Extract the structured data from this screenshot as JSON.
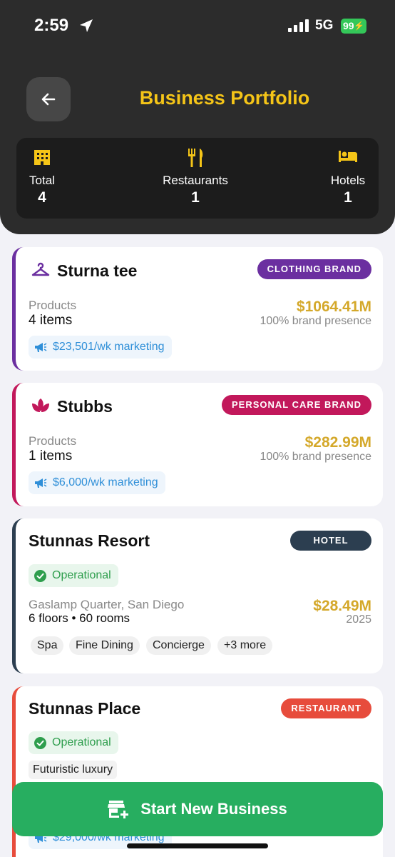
{
  "status_bar": {
    "time": "2:59",
    "network": "5G",
    "battery": "99"
  },
  "header": {
    "title": "Business Portfolio"
  },
  "stats": [
    {
      "label": "Total",
      "value": "4",
      "icon": "building-icon"
    },
    {
      "label": "Restaurants",
      "value": "1",
      "icon": "fork-knife-icon"
    },
    {
      "label": "Hotels",
      "value": "1",
      "icon": "bed-icon"
    }
  ],
  "cards": [
    {
      "name": "Sturna tee",
      "badge": "CLOTHING BRAND",
      "badge_color": "#6b2fa0",
      "accent": "#6b2fa0",
      "icon": "hanger-icon",
      "products_label": "Products",
      "products_value": "4 items",
      "value": "$1064.41M",
      "presence": "100% brand presence",
      "marketing": "$23,501/wk marketing"
    },
    {
      "name": "Stubbs",
      "badge": "PERSONAL CARE BRAND",
      "badge_color": "#c2185b",
      "accent": "#c2185b",
      "icon": "lotus-icon",
      "products_label": "Products",
      "products_value": "1 items",
      "value": "$282.99M",
      "presence": "100% brand presence",
      "marketing": "$6,000/wk marketing"
    },
    {
      "name": "Stunnas Resort",
      "badge": "HOTEL",
      "badge_color": "#2c3e50",
      "accent": "#2c3e50",
      "status": "Operational",
      "location": "Gaslamp Quarter, San Diego",
      "details": "6 floors • 60 rooms",
      "value": "$28.49M",
      "year": "2025",
      "amenities": [
        "Spa",
        "Fine Dining",
        "Concierge",
        "+3 more"
      ]
    },
    {
      "name": "Stunnas Place",
      "badge": "RESTAURANT",
      "badge_color": "#e74c3c",
      "accent": "#e74c3c",
      "status": "Operational",
      "style_tag": "Futuristic luxury",
      "marketing": "$29,000/wk marketing"
    }
  ],
  "cta": {
    "label": "Start New Business",
    "color": "#27ae60"
  }
}
